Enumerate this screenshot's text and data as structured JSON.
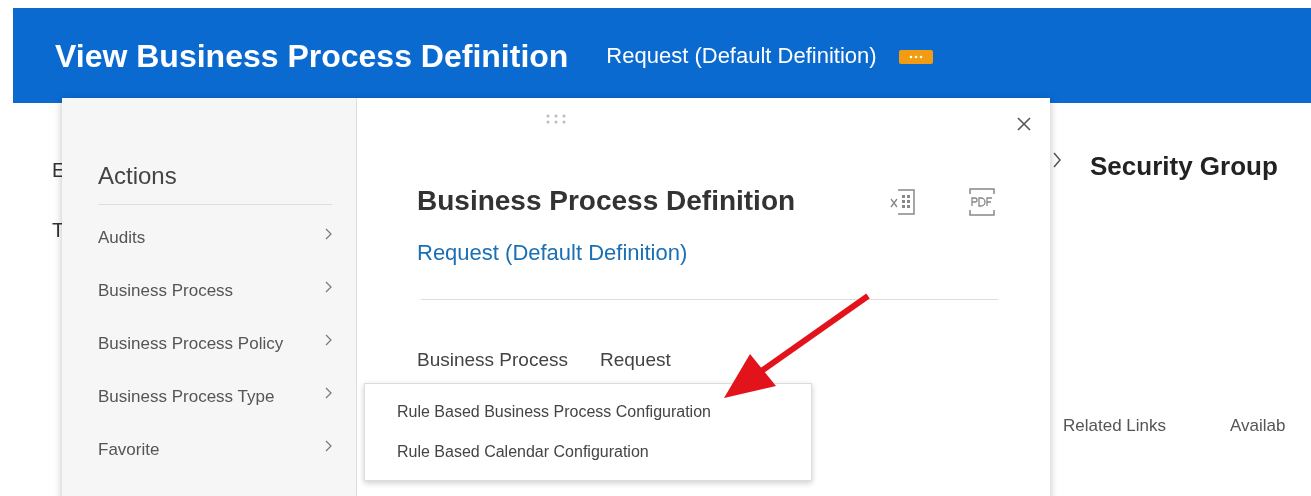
{
  "header": {
    "title": "View Business Process Definition",
    "subtitle": "Request (Default Definition)"
  },
  "background": {
    "left_letters": [
      "E",
      "T"
    ],
    "heading": "Security Group",
    "tabs": [
      "Related Links",
      "Availab"
    ]
  },
  "actions_menu": {
    "title": "Actions",
    "items": [
      {
        "label": "Audits"
      },
      {
        "label": "Business Process"
      },
      {
        "label": "Business Process Policy"
      },
      {
        "label": "Business Process Type",
        "children": [
          {
            "label": "Rule Based Business Process Configuration"
          },
          {
            "label": "Rule Based Calendar Configuration"
          }
        ]
      },
      {
        "label": "Favorite"
      }
    ]
  },
  "detail": {
    "title": "Business Process Definition",
    "link": "Request (Default Definition)",
    "fields": [
      {
        "label": "Business Process",
        "value": "Request"
      }
    ]
  }
}
